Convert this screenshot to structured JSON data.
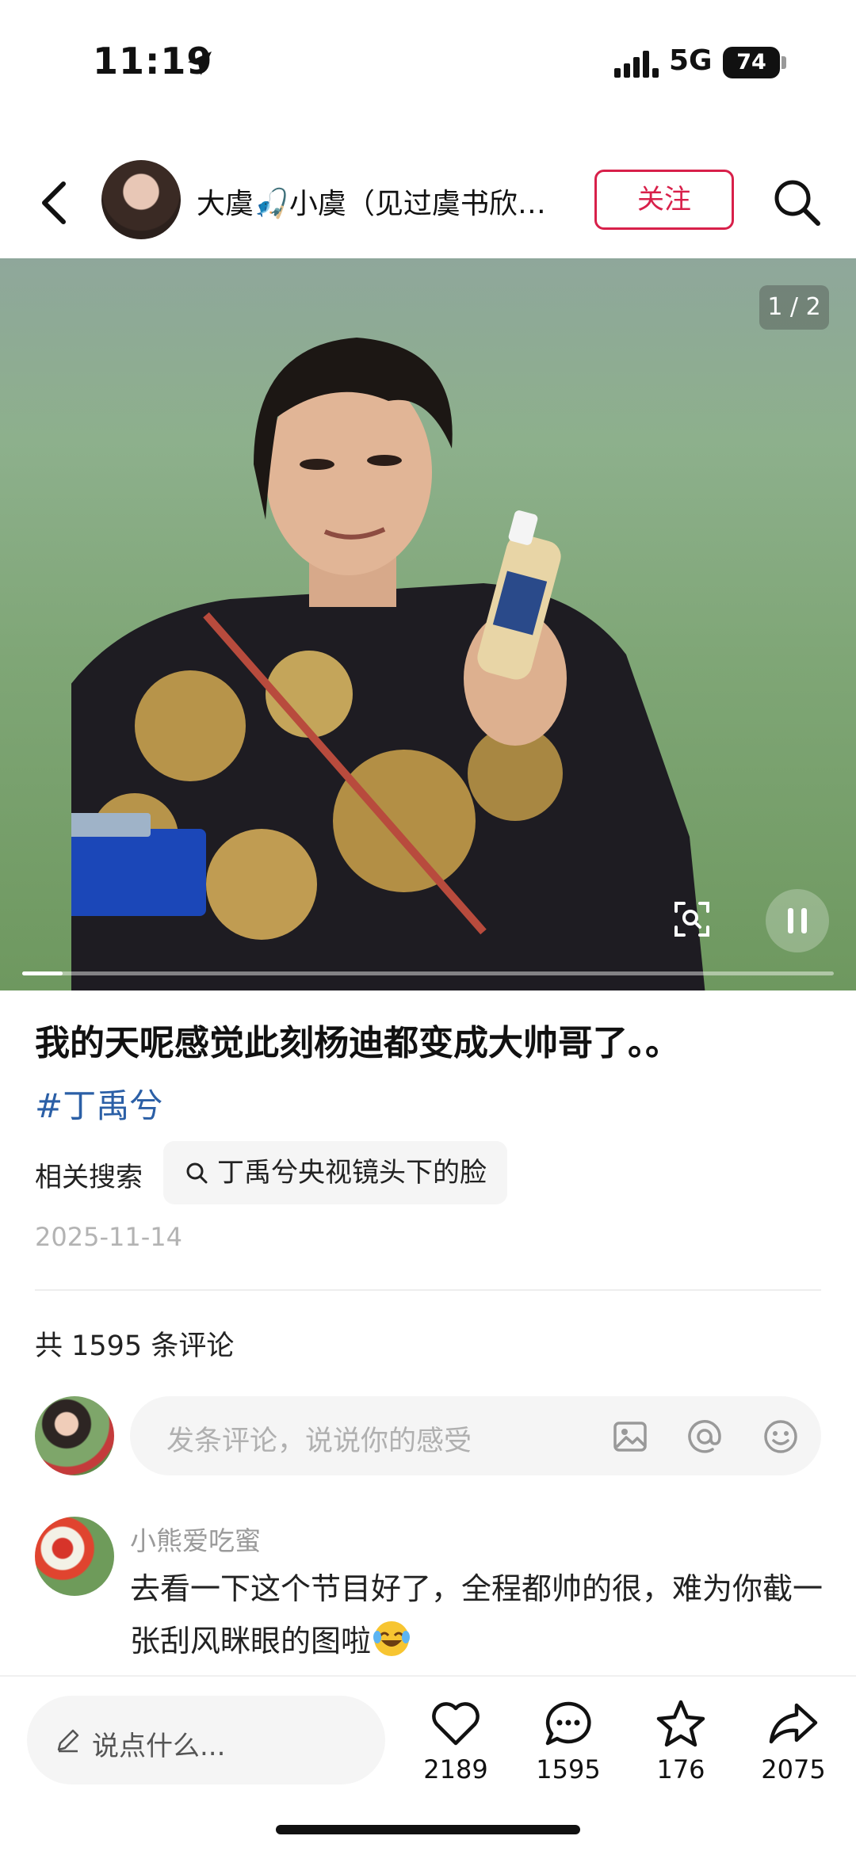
{
  "status_bar": {
    "time": "11:19",
    "network": "5G",
    "battery": "74"
  },
  "header": {
    "author_name": "大虞🎣小虞（见过虞书欣…",
    "follow_label": "关注"
  },
  "media": {
    "page_indicator": "1 / 2",
    "progress": 0.05
  },
  "post": {
    "title": "我的天呢感觉此刻杨迪都变成大帅哥了。。",
    "hashtag": "#丁禹兮",
    "related_label": "相关搜索",
    "related_query": "丁禹兮央视镜头下的脸",
    "date": "2025-11-14"
  },
  "comments": {
    "count_text": "共 1595 条评论",
    "input_placeholder": "发条评论，说说你的感受",
    "items": [
      {
        "user": "小熊爱吃蜜",
        "text": "去看一下这个节目好了，全程都帅的很，难为你截一张刮风眯眼的图啦"
      }
    ]
  },
  "bottom_bar": {
    "input_placeholder": "说点什么...",
    "likes": "2189",
    "comments": "1595",
    "favorites": "176",
    "shares": "2075"
  },
  "colors": {
    "accent": "#d8204a",
    "hashtag": "#2b5fa6"
  }
}
